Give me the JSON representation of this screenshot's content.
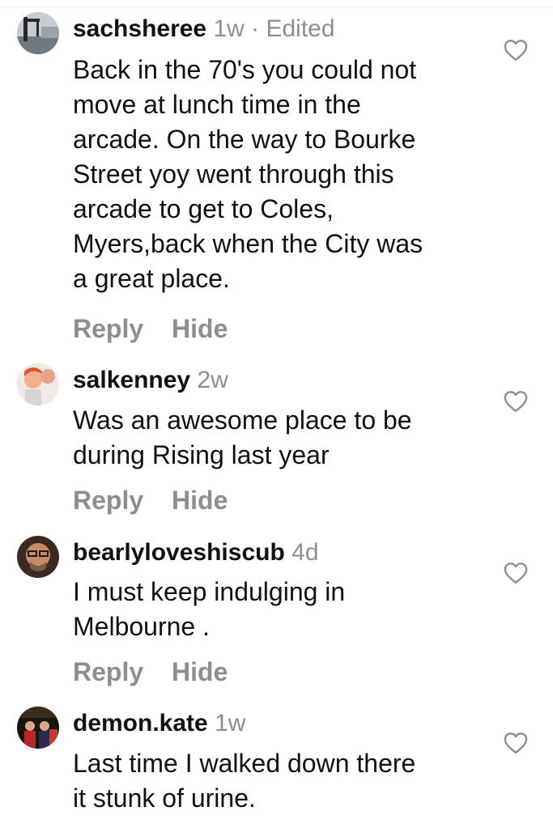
{
  "comments": [
    {
      "username": "sachsheree",
      "meta": "1w · Edited",
      "lines": [
        "Back in the 70's you could not",
        "move at lunch time in the",
        "arcade. On the way to Bourke",
        "Street yoy went through this",
        "arcade to get to Coles,",
        "Myers,back when the City was",
        "a great place."
      ],
      "reply": "Reply",
      "hide": "Hide",
      "like_icon": "heart-outline-icon"
    },
    {
      "username": "salkenney",
      "meta": "2w",
      "lines": [
        "Was an awesome place to be",
        "during Rising last year"
      ],
      "reply": "Reply",
      "hide": "Hide",
      "like_icon": "heart-outline-icon"
    },
    {
      "username": "bearlyloveshiscub",
      "meta": "4d",
      "lines": [
        "I must keep indulging in",
        "Melbourne ."
      ],
      "reply": "Reply",
      "hide": "Hide",
      "like_icon": "heart-outline-icon"
    },
    {
      "username": "demon.kate",
      "meta": "1w",
      "lines": [
        "Last time I walked down there",
        "it stunk of urine."
      ],
      "like_icon": "heart-outline-icon"
    }
  ],
  "colors": {
    "text": "#111111",
    "muted": "#8e8e8e"
  }
}
